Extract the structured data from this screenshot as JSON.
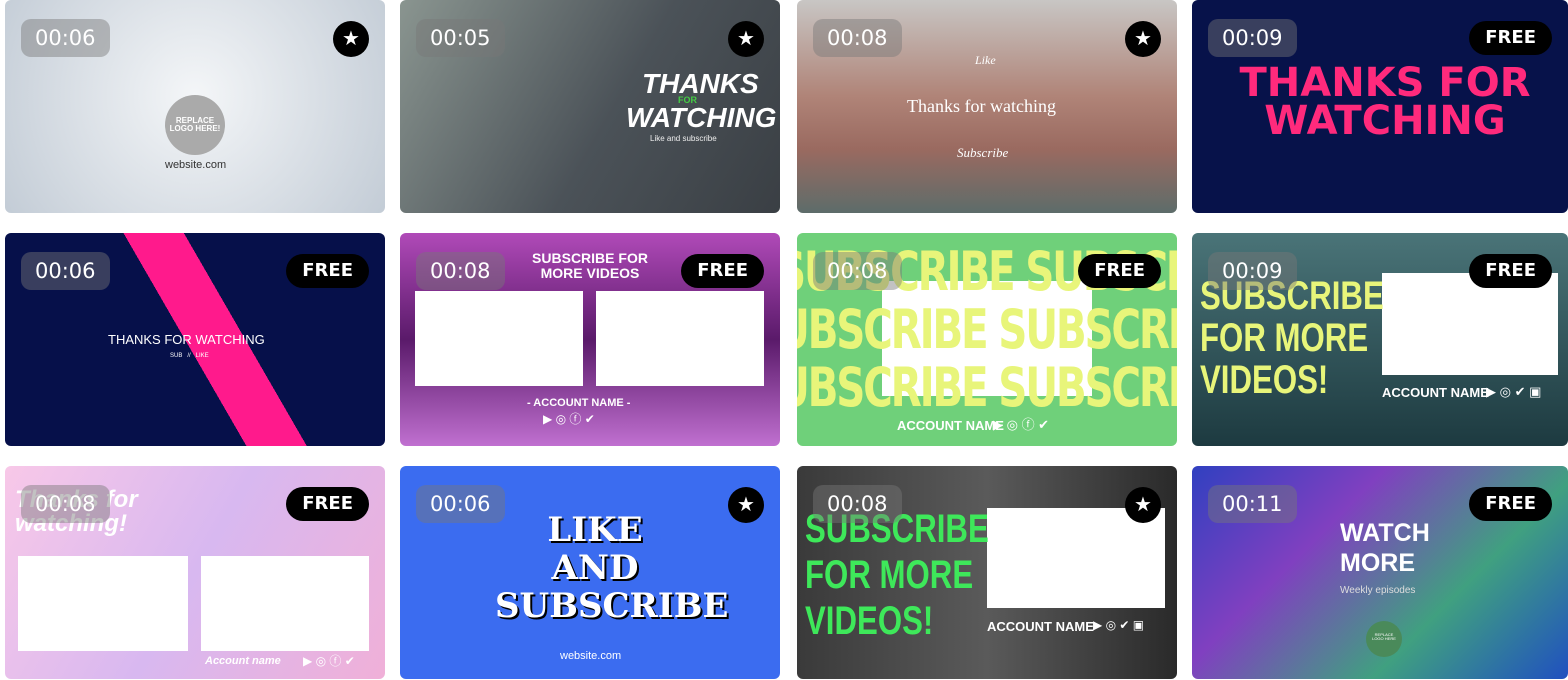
{
  "templates": [
    {
      "duration": "00:06",
      "badge": "star",
      "texts": [
        "REPLACE\nLOGO HERE!",
        "website.com"
      ]
    },
    {
      "duration": "00:05",
      "badge": "star",
      "texts": [
        "THANKS",
        "FOR",
        "WATCHING",
        "Like and subscribe"
      ]
    },
    {
      "duration": "00:08",
      "badge": "star",
      "texts": [
        "Like",
        "Thanks for watching",
        "Subscribe"
      ]
    },
    {
      "duration": "00:09",
      "badge": "FREE",
      "texts": [
        "THANKS FOR\nWATCHING"
      ]
    },
    {
      "duration": "00:06",
      "badge": "FREE",
      "texts": [
        "THANKS FOR WATCHING",
        "SUB   //   LIKE"
      ]
    },
    {
      "duration": "00:08",
      "badge": "FREE",
      "texts": [
        "SUBSCRIBE FOR\nMORE VIDEOS",
        "- ACCOUNT NAME -",
        "▶ ◎ ⓕ ✔"
      ]
    },
    {
      "duration": "00:08",
      "badge": "FREE",
      "texts": [
        "SUBSCRIBE SUBSCRIBE\nUBSCRIBE SUBSCRIB\nUBSCRIBE SUBSCRIB",
        "ACCOUNT NAME",
        "▶ ◎ ⓕ ✔"
      ]
    },
    {
      "duration": "00:09",
      "badge": "FREE",
      "texts": [
        "SUBSCRIBE\nFOR MORE\nVIDEOS!",
        "ACCOUNT NAME",
        "▶ ◎ ✔ ▣"
      ]
    },
    {
      "duration": "00:08",
      "badge": "FREE",
      "texts": [
        "Thanks for\nwatching!",
        "Account name",
        "▶ ◎ ⓕ ✔"
      ]
    },
    {
      "duration": "00:06",
      "badge": "star",
      "texts": [
        "LIKE\nAND\nSUBSCRIBE",
        "website.com"
      ]
    },
    {
      "duration": "00:08",
      "badge": "star",
      "texts": [
        "SUBSCRIBE\nFOR MORE\nVIDEOS!",
        "ACCOUNT NAME",
        "▶ ◎ ✔ ▣"
      ]
    },
    {
      "duration": "00:11",
      "badge": "FREE",
      "texts": [
        "WATCH\nMORE",
        "Weekly episodes",
        "REPLACE\nLOGO HERE"
      ]
    }
  ],
  "colors": {
    "badge_bg": "#000000",
    "accent_pink": "#ff1a8c",
    "accent_yellow": "#e8f57a",
    "accent_green": "#3ee85a"
  }
}
